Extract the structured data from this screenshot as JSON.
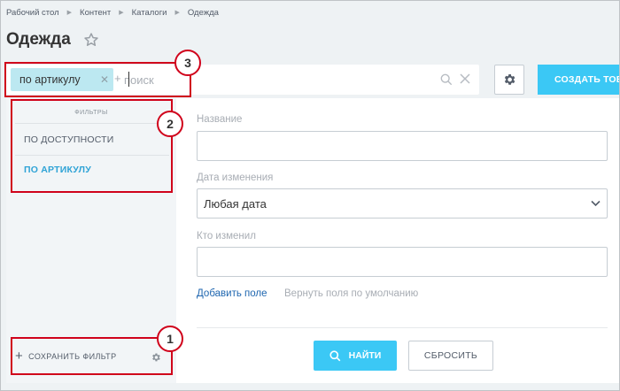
{
  "breadcrumb": [
    "Рабочий стол",
    "Контент",
    "Каталоги",
    "Одежда"
  ],
  "page_title": "Одежда",
  "search": {
    "chip_label": "по артикулу",
    "plus": "+",
    "placeholder": "поиск"
  },
  "toolbar": {
    "create_label": "СОЗДАТЬ ТОВ"
  },
  "filters": {
    "heading": "ФИЛЬТРЫ",
    "items": [
      {
        "label": "ПО ДОСТУПНОСТИ",
        "active": false
      },
      {
        "label": "ПО АРТИКУЛУ",
        "active": true
      }
    ],
    "save_label": "СОХРАНИТЬ ФИЛЬТР"
  },
  "form": {
    "name_label": "Название",
    "name_value": "",
    "date_label": "Дата изменения",
    "date_value": "Любая дата",
    "modified_by_label": "Кто изменил",
    "modified_by_value": "",
    "add_field_link": "Добавить поле",
    "reset_fields_link": "Вернуть поля по умолчанию",
    "find_label": "НАЙТИ",
    "reset_label": "СБРОСИТЬ"
  },
  "callouts": [
    "1",
    "2",
    "3"
  ],
  "colors": {
    "accent": "#3bc8f5",
    "callout": "#d0021b",
    "chip": "#bce8f1",
    "link": "#2067b0",
    "active_filter": "#2fa3d6"
  },
  "icons": [
    "star-icon",
    "magnifier-icon",
    "clear-icon",
    "gear-icon",
    "chevron-down-icon",
    "plus-icon"
  ]
}
